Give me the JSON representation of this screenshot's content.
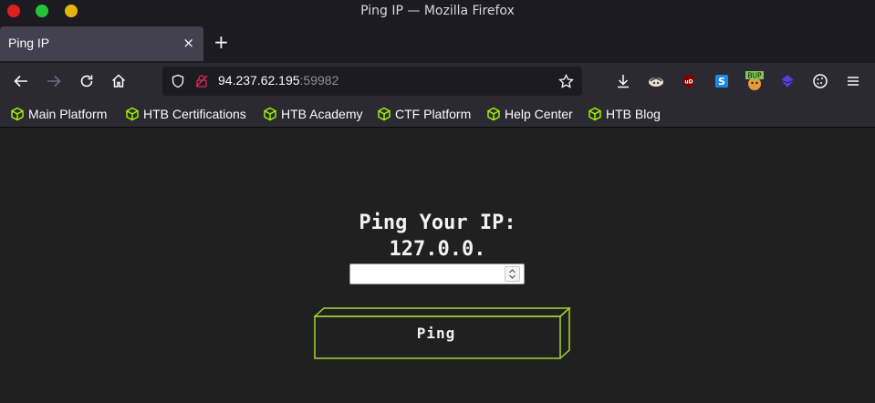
{
  "window": {
    "title": "Ping IP — Mozilla Firefox"
  },
  "tabs": [
    {
      "title": "Ping IP",
      "close": "×"
    }
  ],
  "new_tab": "+",
  "urlbar": {
    "host": "94.237.62.195",
    "port": ":59982"
  },
  "toolbar": {
    "icons": [
      "back-icon",
      "forward-icon",
      "reload-icon",
      "home-icon",
      "downloads-icon",
      "extension-icon",
      "ublock-icon",
      "extension-s-icon",
      "burp-icon",
      "extension-purple-icon",
      "cookie-icon",
      "menu-icon"
    ],
    "burp_badge": "BUP",
    "ublock_badge": "uD",
    "s_badge": "S"
  },
  "bookmarks": [
    {
      "label": "Main Platform"
    },
    {
      "label": "HTB Certifications"
    },
    {
      "label": "HTB Academy"
    },
    {
      "label": "CTF Platform"
    },
    {
      "label": "Help Center"
    },
    {
      "label": "HTB Blog"
    }
  ],
  "content": {
    "heading_line1": "Ping Your IP:",
    "heading_line2": "127.0.0.",
    "input_value": "",
    "button_label": "Ping"
  },
  "colors": {
    "accent_green": "#9fef00",
    "button_outline": "#a4d233",
    "page_bg": "#202020"
  }
}
